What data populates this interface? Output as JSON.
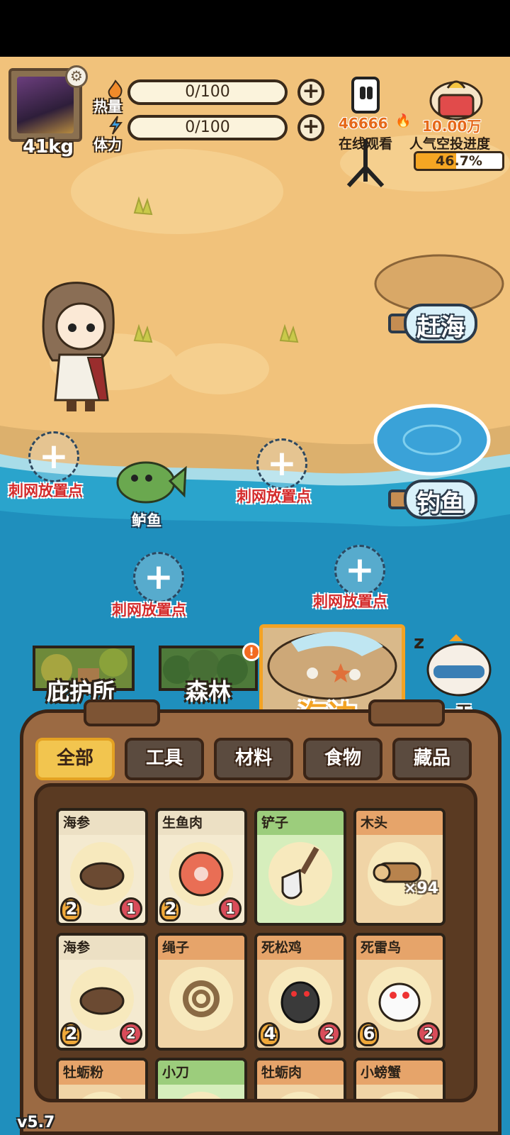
{
  "player": {
    "weight": "41kg",
    "stats": [
      {
        "label": "热量",
        "value": "0/100"
      },
      {
        "label": "体力",
        "value": "0/100"
      }
    ]
  },
  "hud": {
    "viewers_count": "46666",
    "viewers_label": "在线观看",
    "airdrop_target": "10.00万",
    "airdrop_label": "人气空投进度",
    "airdrop_progress_text": "46.7%",
    "airdrop_progress": 0.467
  },
  "actions": {
    "gather": "赶海",
    "fishing": "钓鱼"
  },
  "scene": {
    "fish_label": "鲈鱼",
    "net_label": "刺网放置点"
  },
  "locations": [
    {
      "name": "庇护所"
    },
    {
      "name": "森林",
      "alert": "!"
    },
    {
      "name": "海边",
      "selected": true
    }
  ],
  "next_day": {
    "label": "下一天"
  },
  "inventory": {
    "tabs": [
      {
        "label": "全部",
        "active": true
      },
      {
        "label": "工具"
      },
      {
        "label": "材料"
      },
      {
        "label": "食物"
      },
      {
        "label": "藏品"
      }
    ],
    "items": [
      {
        "name": "海参",
        "level": "2",
        "count": "1",
        "style": "plain",
        "icon": "sea-cucumber-icon"
      },
      {
        "name": "生鱼肉",
        "level": "2",
        "count": "1",
        "style": "plain",
        "icon": "raw-fish-icon"
      },
      {
        "name": "铲子",
        "style": "green",
        "icon": "shovel-icon"
      },
      {
        "name": "木头",
        "quantity": "×94",
        "style": "orange",
        "icon": "wood-icon"
      },
      {
        "name": "海参",
        "level": "2",
        "count": "2",
        "style": "plain",
        "icon": "sea-cucumber-icon"
      },
      {
        "name": "绳子",
        "style": "orange",
        "icon": "rope-icon"
      },
      {
        "name": "死松鸡",
        "level": "4",
        "count": "2",
        "style": "orange",
        "icon": "grouse-icon"
      },
      {
        "name": "死雷鸟",
        "level": "6",
        "count": "2",
        "style": "orange",
        "icon": "ptarmigan-icon"
      },
      {
        "name": "牡蛎粉",
        "style": "orange",
        "icon": "oyster-powder-icon"
      },
      {
        "name": "小刀",
        "style": "green",
        "icon": "knife-icon"
      },
      {
        "name": "牡蛎肉",
        "style": "orange",
        "icon": "oyster-meat-icon"
      },
      {
        "name": "小螃蟹",
        "style": "orange",
        "icon": "crab-icon"
      }
    ]
  },
  "version": "v5.7"
}
